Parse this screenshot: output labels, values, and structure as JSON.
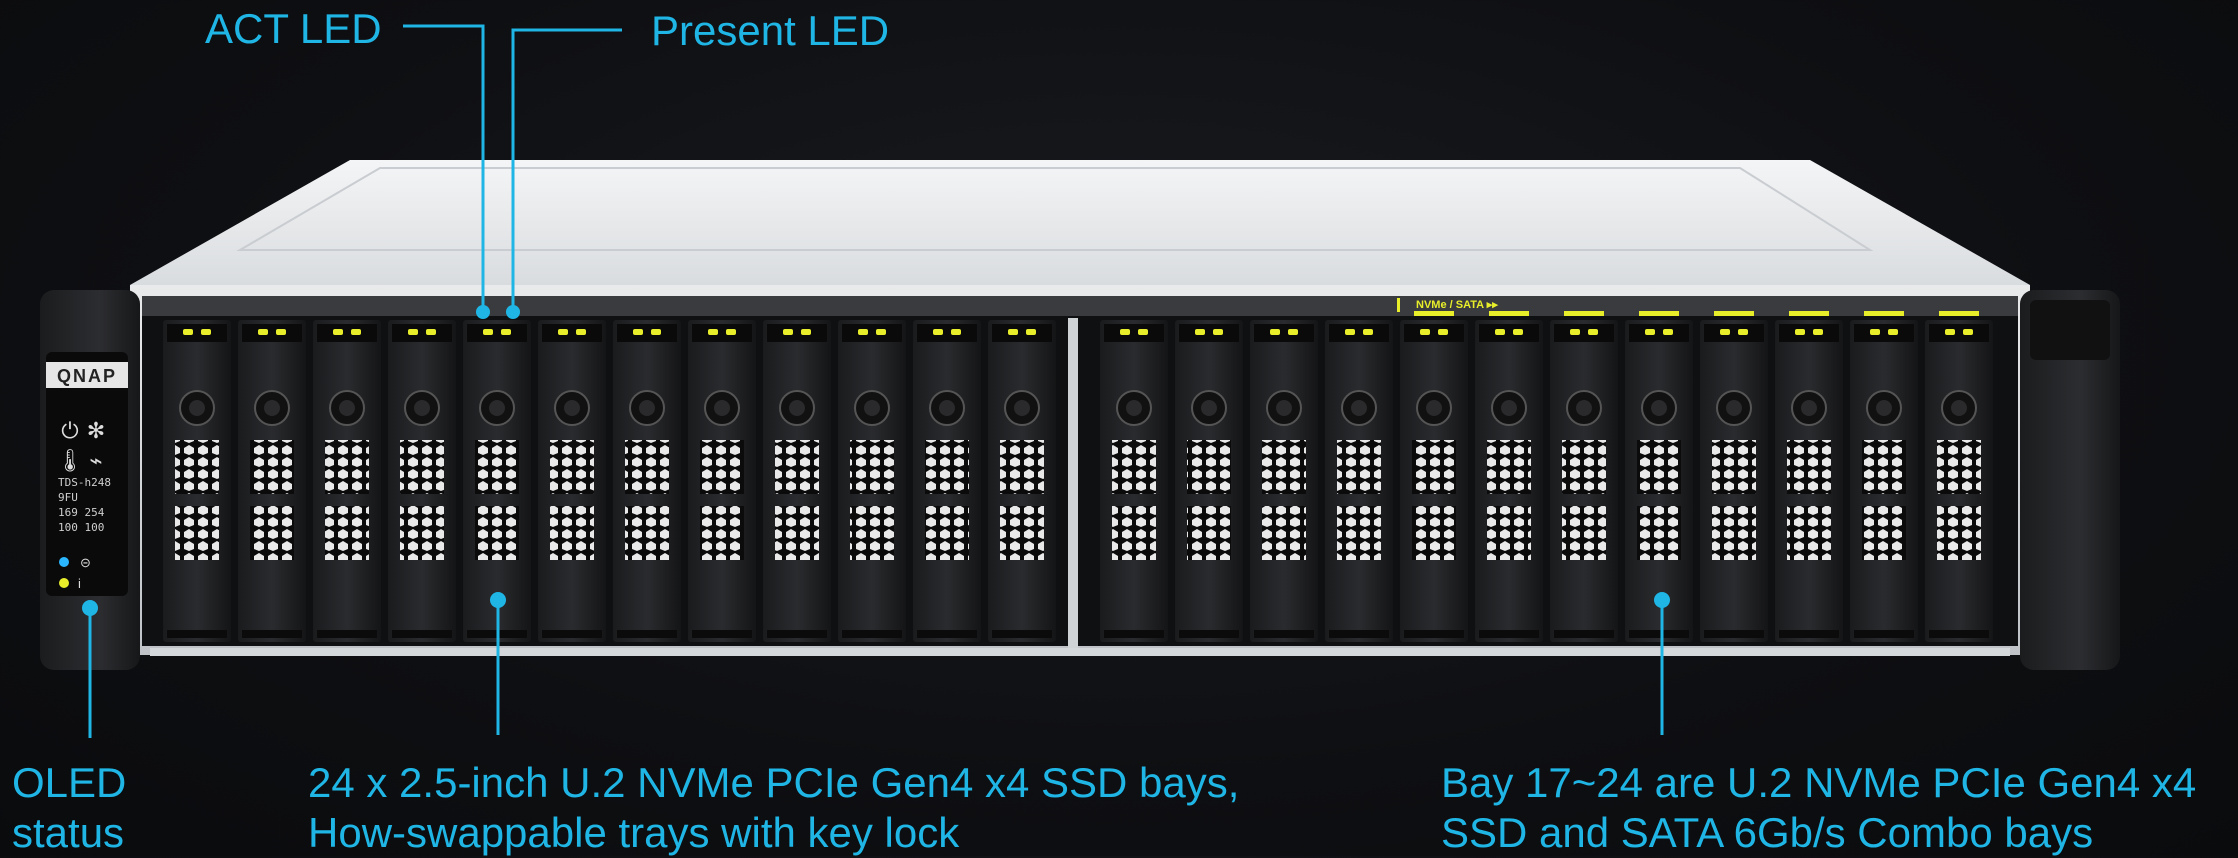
{
  "labels": {
    "act_led": "ACT LED",
    "present_led": "Present LED",
    "oled_line1": "OLED",
    "oled_line2": "status",
    "bays_line1": "24 x 2.5-inch U.2 NVMe PCIe Gen4 x4 SSD bays,",
    "bays_line2": "How-swappable trays with key lock",
    "combo_line1": "Bay 17~24 are U.2 NVMe PCIe Gen4 x4",
    "combo_line2": "SSD and SATA 6Gb/s Combo bays"
  },
  "device": {
    "brand": "QNAP",
    "combo_mark": "NVMe / SATA ▸▸",
    "oled_text": [
      "TDS-h248",
      "9FU",
      "169  254",
      "100  100"
    ],
    "bay_count": 24
  },
  "colors": {
    "accent": "#1fb6e6",
    "led_yellow": "#e8ef2a",
    "led_blue": "#2ab7ff"
  }
}
